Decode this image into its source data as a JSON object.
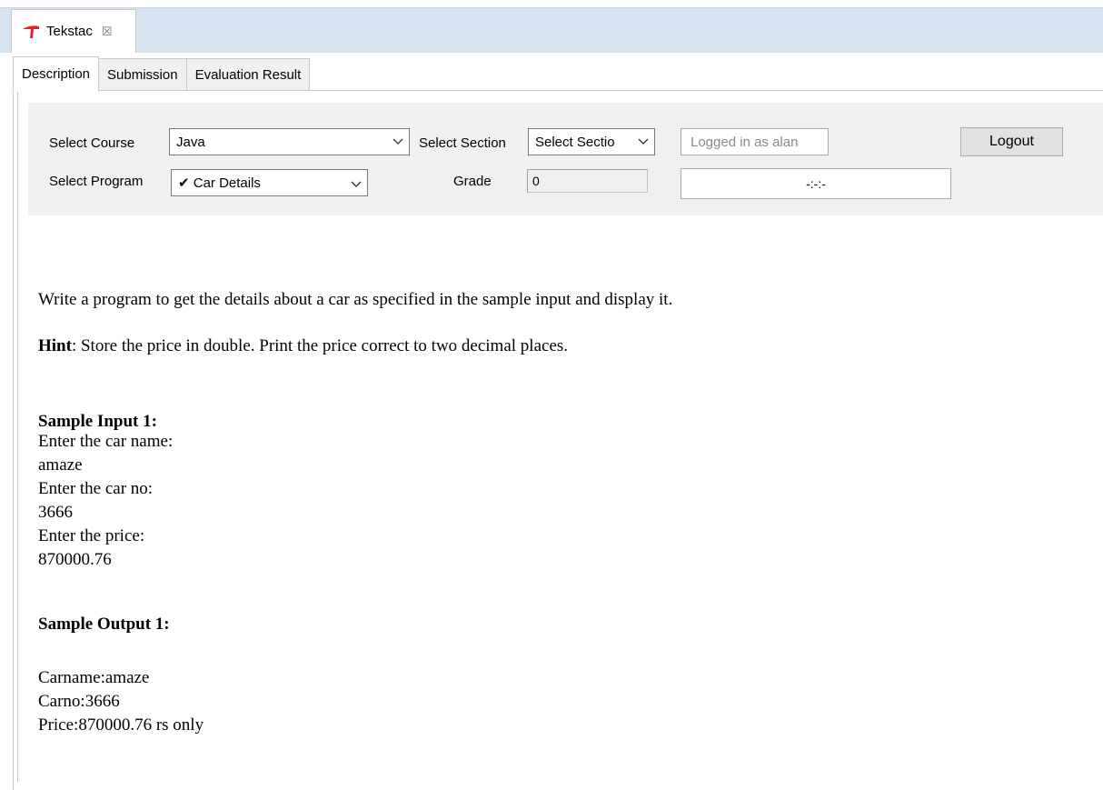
{
  "view_tab": {
    "title": "Tekstac",
    "close_glyph": "☒"
  },
  "tabs": [
    "Description",
    "Submission",
    "Evaluation Result"
  ],
  "form": {
    "course_label": "Select Course",
    "course_value": "Java",
    "section_label": "Select Section",
    "section_value": "Select Sectio",
    "logged_in": "Logged in as alan",
    "logout_label": "Logout",
    "program_label": "Select Program",
    "program_value": "✔ Car Details",
    "grade_label": "Grade",
    "grade_value": "0",
    "timer": "-:-:-"
  },
  "description": {
    "intro": "Write a program to get the details about a car as specified in the sample input and display it.",
    "hint_label": "Hint",
    "hint_text": ": Store the price in double. Print the price correct to two decimal places.",
    "sample_input_heading": "Sample Input 1:",
    "sample_input_lines": [
      "Enter the car name:",
      "amaze",
      "Enter the car no:",
      "3666",
      "Enter the price:",
      "870000.76"
    ],
    "sample_output_heading": "Sample Output 1:",
    "sample_output_lines": [
      "Carname:amaze",
      "Carno:3666",
      "Price:870000.76 rs only"
    ]
  },
  "colors": {
    "tab_strip": "#d6e3f1",
    "panel_bg": "#f0f0f0",
    "logo_red": "#e0202a"
  }
}
